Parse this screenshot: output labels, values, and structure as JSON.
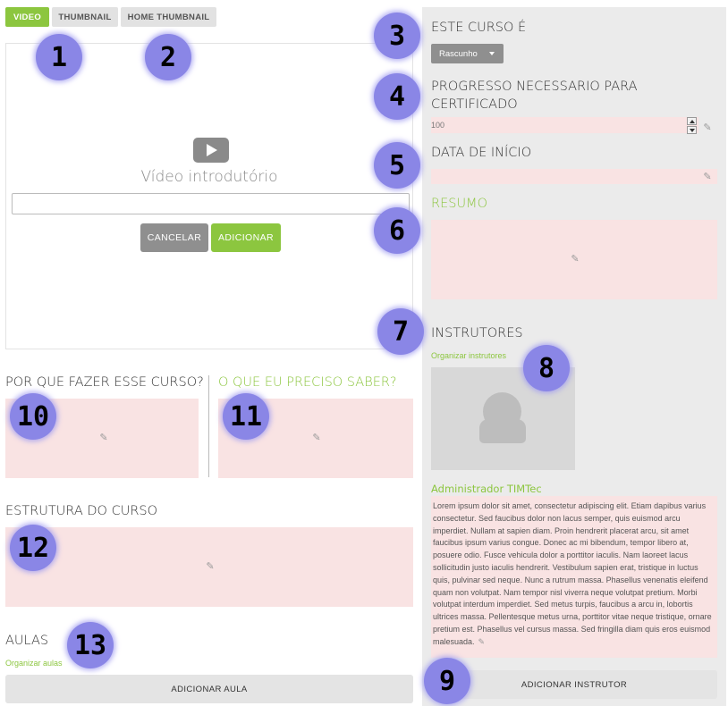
{
  "tabs": [
    {
      "label": "VIDEO",
      "active": true
    },
    {
      "label": "THUMBNAIL",
      "active": false
    },
    {
      "label": "HOME THUMBNAIL",
      "active": false
    }
  ],
  "video": {
    "title": "Vídeo introdutório",
    "input_value": "",
    "cancel_label": "CANCELAR",
    "add_label": "ADICIONAR"
  },
  "main": {
    "why_title": "POR QUE FAZER ESSE CURSO?",
    "requirements_title": "O QUE EU PRECISO SABER?",
    "structure_title": "ESTRUTURA DO CURSO",
    "lessons_title": "AULAS",
    "organize_lessons": "Organizar aulas",
    "add_lesson": "ADICIONAR AULA"
  },
  "sidebar": {
    "status_title": "ESTE CURSO É",
    "status_value": "Rascunho",
    "progress_title": "PROGRESSO NECESSARIO PARA CERTIFICADO",
    "progress_value": "100",
    "start_date_title": "DATA DE INÍCIO",
    "summary_title": "RESUMO",
    "instructors_title": "INSTRUTORES",
    "organize_instructors": "Organizar instrutores",
    "instructor_name": "Administrador TIMTec",
    "instructor_bio": "Lorem ipsum dolor sit amet, consectetur adipiscing elit. Etiam dapibus varius consectetur. Sed faucibus dolor non lacus semper, quis euismod arcu imperdiet. Nullam at sapien diam. Proin hendrerit placerat arcu, sit amet faucibus ipsum varius congue. Donec ac mi bibendum, tempor libero at, posuere odio. Fusce vehicula dolor a porttitor iaculis. Nam laoreet lacus sollicitudin justo iaculis hendrerit. Vestibulum sapien erat, tristique in luctus quis, pulvinar sed neque. Nunc a rutrum massa. Phasellus venenatis eleifend quam non volutpat. Nam tempor nisl viverra neque volutpat pretium. Morbi volutpat interdum imperdiet. Sed metus turpis, faucibus a arcu in, lobortis ultrices massa. Pellentesque metus urna, porttitor vitae neque tristique, ornare pretium est. Phasellus vel cursus massa. Sed fringilla diam quis eros euismod malesuada.",
    "add_instructor": "ADICIONAR INSTRUTOR"
  },
  "markers": [
    "1",
    "2",
    "3",
    "4",
    "5",
    "6",
    "7",
    "8",
    "9",
    "10",
    "11",
    "12",
    "13"
  ],
  "colors": {
    "accent": "#8cc63f",
    "editable_bg": "#f9e3e3",
    "marker": "#8a86e6",
    "sidebar_bg": "#ebebeb"
  },
  "icons": [
    "play-icon",
    "pencil-icon",
    "user-placeholder-icon",
    "caret-down-icon",
    "spinner-up-icon",
    "spinner-down-icon"
  ]
}
